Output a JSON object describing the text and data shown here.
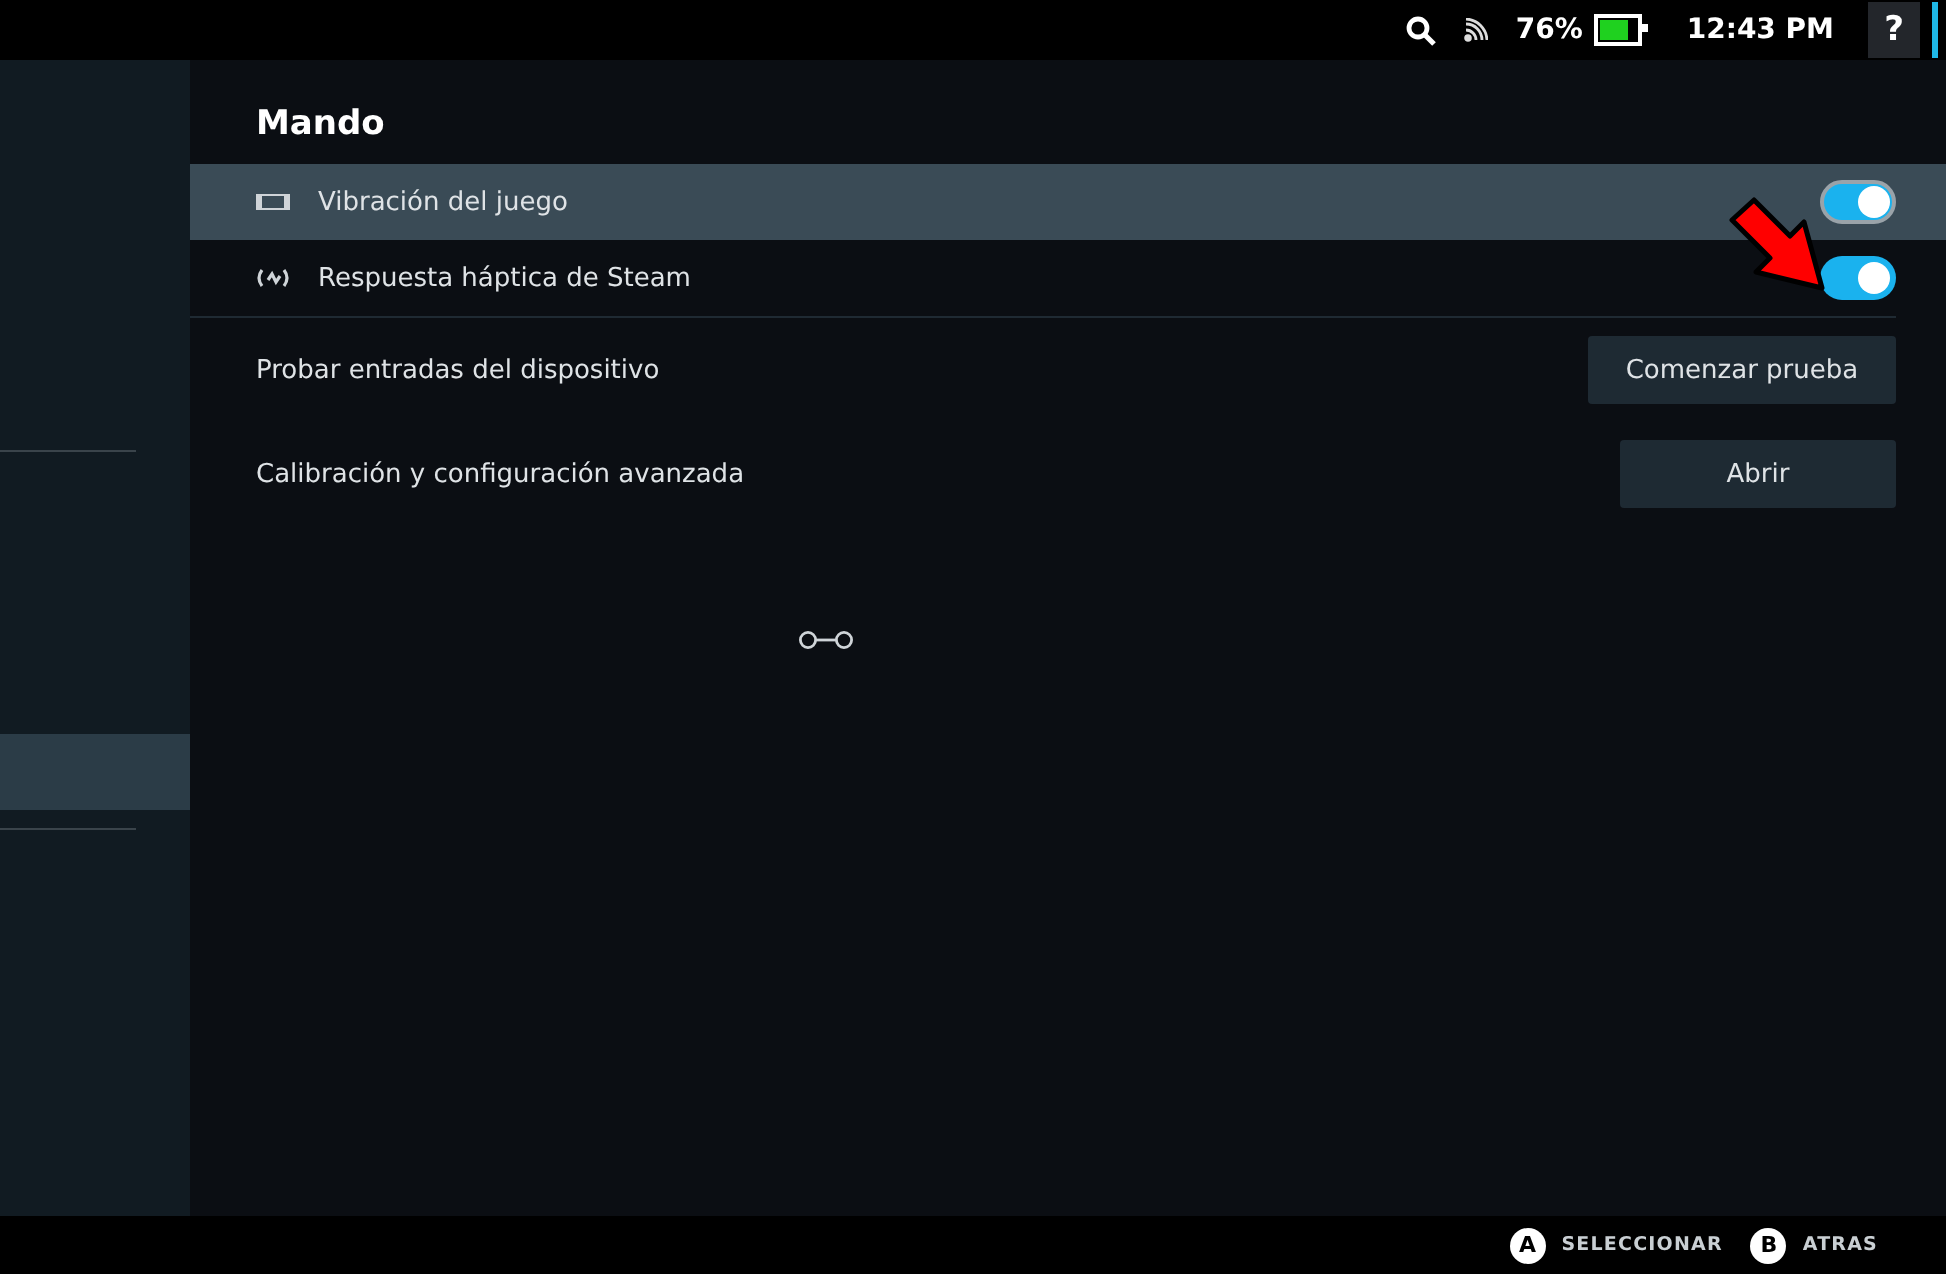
{
  "status_bar": {
    "battery_text": "76%",
    "time": "12:43 PM",
    "help": "?"
  },
  "section": {
    "title": "Mando"
  },
  "settings": [
    {
      "kind": "toggle",
      "label": "Vibración del juego",
      "on": true,
      "focused": true
    },
    {
      "kind": "toggle",
      "label": "Respuesta háptica de Steam",
      "on": true,
      "focused": false
    },
    {
      "kind": "button",
      "label": "Probar entradas del dispositivo",
      "button": "Comenzar prueba"
    },
    {
      "kind": "button",
      "label": "Calibración y configuración avanzada",
      "button": "Abrir"
    }
  ],
  "footer": [
    {
      "key": "A",
      "label": "SELECCIONAR"
    },
    {
      "key": "B",
      "label": "ATRAS"
    }
  ]
}
